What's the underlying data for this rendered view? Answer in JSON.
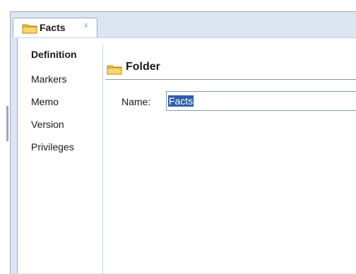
{
  "tab": {
    "label": "Facts",
    "close_glyph": "x",
    "icon": "folder-icon"
  },
  "nav": {
    "items": [
      {
        "label": "Definition",
        "active": true
      },
      {
        "label": "Markers",
        "active": false
      },
      {
        "label": "Memo",
        "active": false
      },
      {
        "label": "Version",
        "active": false
      },
      {
        "label": "Privileges",
        "active": false
      }
    ]
  },
  "section": {
    "title": "Folder",
    "icon": "folder-icon"
  },
  "form": {
    "name_label": "Name:",
    "name_value": "Facts"
  },
  "colors": {
    "frame": "#dce6f3",
    "selection": "#2f5fa8",
    "folder": "#f5c542"
  }
}
